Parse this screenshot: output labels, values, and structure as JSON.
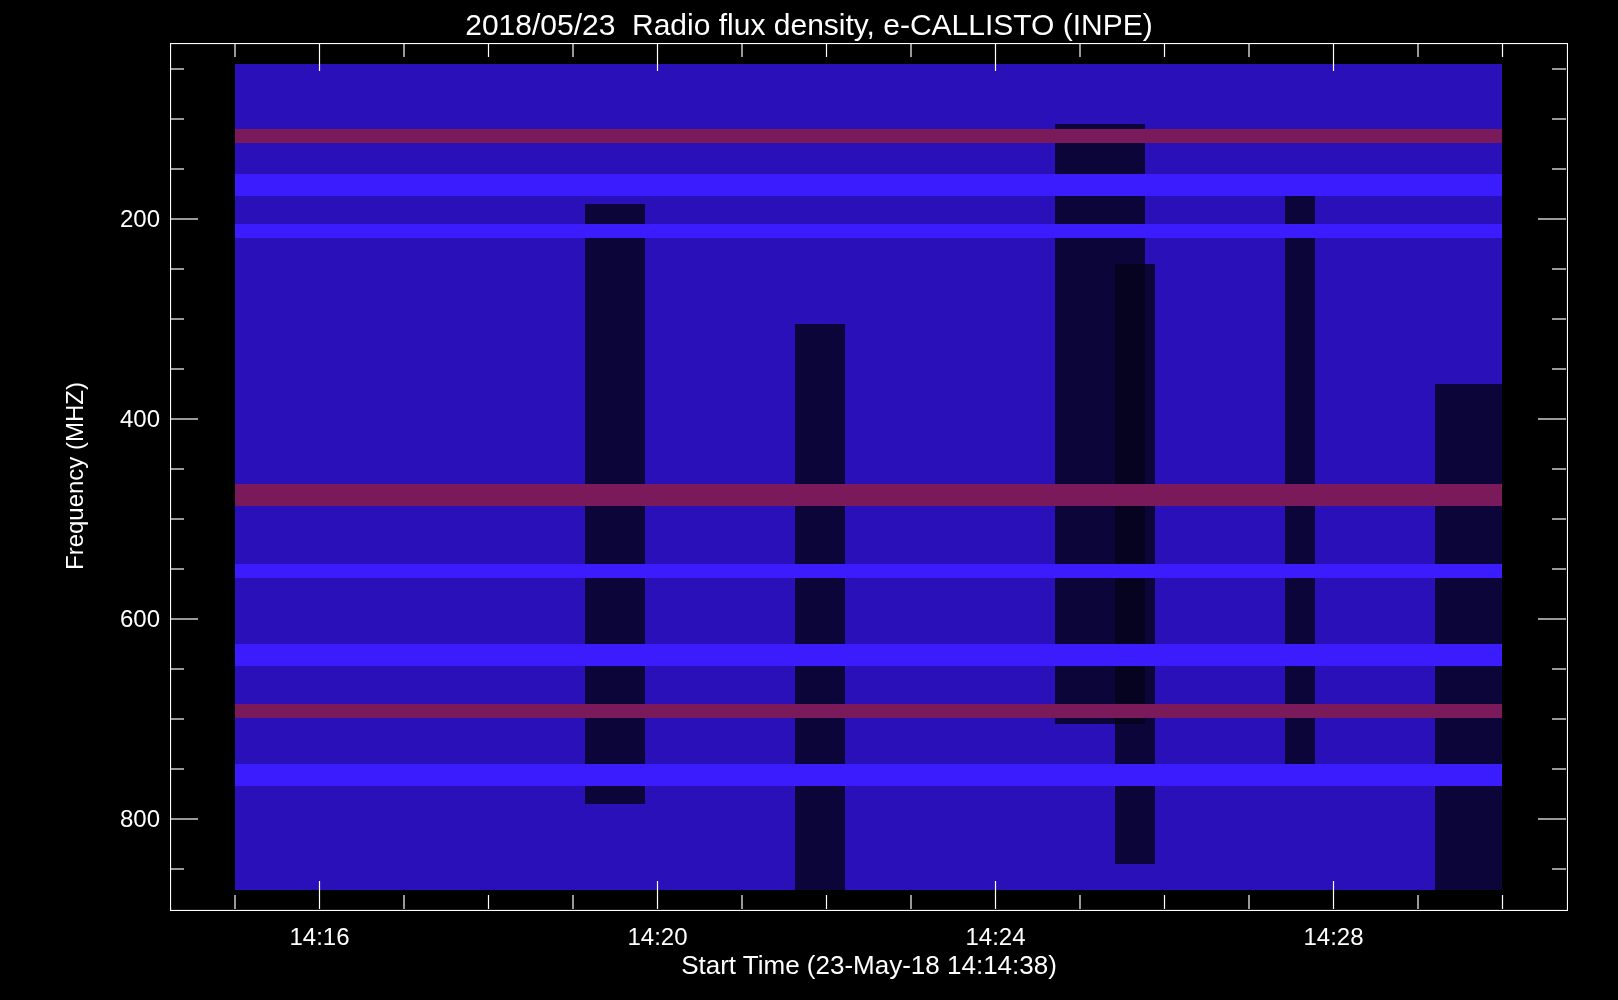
{
  "title": "2018/05/23  Radio flux density, e-CALLISTO (INPE)",
  "y_axis": {
    "label": "Frequency (MHZ)",
    "ticks": [
      "200",
      "400",
      "600",
      "800"
    ]
  },
  "x_axis": {
    "label": "Start Time (23-May-18 14:14:38)",
    "ticks": [
      "14:16",
      "14:20",
      "14:24",
      "14:28"
    ]
  }
}
